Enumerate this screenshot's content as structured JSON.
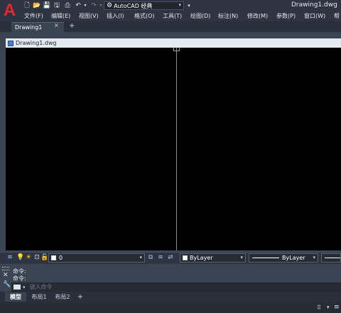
{
  "app": {
    "logo_letter": "A",
    "title": "Drawing1.dwg"
  },
  "quick_access": {
    "icons": [
      "new-icon",
      "open-icon",
      "save-icon",
      "saveas-icon",
      "print-icon",
      "undo-icon",
      "redo-icon"
    ]
  },
  "workspace": {
    "label": "AutoCAD 经典"
  },
  "menu": {
    "items": [
      {
        "label": "文件(F)"
      },
      {
        "label": "编辑(E)"
      },
      {
        "label": "视图(V)"
      },
      {
        "label": "插入(I)"
      },
      {
        "label": "格式(O)"
      },
      {
        "label": "工具(T)"
      },
      {
        "label": "绘图(D)"
      },
      {
        "label": "标注(N)"
      },
      {
        "label": "修改(M)"
      },
      {
        "label": "参数(P)"
      },
      {
        "label": "窗口(W)"
      },
      {
        "label": "帮"
      }
    ]
  },
  "doc_tabs": {
    "active": "Drawing1",
    "close": "×",
    "add": "+"
  },
  "viewport": {
    "title": "Drawing1.dwg"
  },
  "toolbar": {
    "layer": "0",
    "color": "ByLayer",
    "linetype": "ByLayer",
    "arrow": "⌄"
  },
  "command": {
    "history": [
      "命令:",
      "命令:"
    ],
    "placeholder": "键入命令"
  },
  "layout_tabs": {
    "model": "模型",
    "layout1": "布局1",
    "layout2": "布局2",
    "add": "+"
  },
  "colors": {
    "canvas": "#000000",
    "accent": "#e5272d"
  }
}
